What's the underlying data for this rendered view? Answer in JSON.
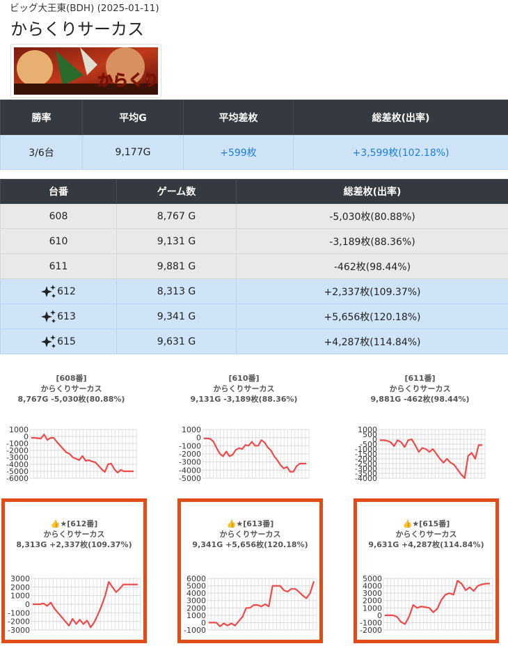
{
  "header": {
    "store_date": "ビッグ大王東(BDH) (2025-01-11)",
    "machine_title": "からくりサーカス",
    "banner_text": "からくりサーカス"
  },
  "summary": {
    "headers": [
      "勝率",
      "平均G",
      "平均差枚",
      "総差枚(出率)"
    ],
    "values": [
      "3/6台",
      "9,177G",
      "+599枚",
      "+3,599枚(102.18%)"
    ]
  },
  "units": {
    "headers": [
      "台番",
      "ゲーム数",
      "総差枚(出率)"
    ],
    "rows": [
      {
        "number": "608",
        "games": "8,767 G",
        "diff": "-5,030枚(80.88%)",
        "highlight": false
      },
      {
        "number": "610",
        "games": "9,131 G",
        "diff": "-3,189枚(88.36%)",
        "highlight": false
      },
      {
        "number": "611",
        "games": "9,881 G",
        "diff": "-462枚(98.44%)",
        "highlight": false
      },
      {
        "number": "612",
        "games": "8,313 G",
        "diff": "+2,337枚(109.37%)",
        "highlight": true
      },
      {
        "number": "613",
        "games": "9,341 G",
        "diff": "+5,656枚(120.18%)",
        "highlight": true
      },
      {
        "number": "615",
        "games": "9,631 G",
        "diff": "+4,287枚(114.84%)",
        "highlight": true
      }
    ]
  },
  "colors": {
    "line": "#f04848",
    "frame": "#e24a16",
    "header_bg": "#343a40",
    "highlight_bg": "#cfe4f7",
    "accent_text": "#1a7ee0"
  },
  "chart_data": [
    {
      "type": "line",
      "title": "[608番]",
      "subtitle": "からくりサーカス",
      "caption": "8,767G -5,030枚(80.88%)",
      "ylim": [
        -6000,
        1000
      ],
      "yticks": [
        1000,
        0,
        -1000,
        -2000,
        -3000,
        -4000,
        -5000,
        -6000
      ],
      "values": [
        -200,
        -200,
        -250,
        -300,
        300,
        -500,
        -200,
        -200,
        -800,
        -1300,
        -1800,
        -2300,
        -2500,
        -3000,
        -3200,
        -3400,
        -2800,
        -3500,
        -3400,
        -3600,
        -3700,
        -4200,
        -4700,
        -5100,
        -4000,
        -3900,
        -4700,
        -5200,
        -4800,
        -5000,
        -5000,
        -5000,
        -5000
      ]
    },
    {
      "type": "line",
      "title": "[610番]",
      "subtitle": "からくりサーカス",
      "caption": "9,131G -3,189枚(88.36%)",
      "ylim": [
        -5000,
        1000
      ],
      "yticks": [
        1000,
        0,
        -1000,
        -2000,
        -3000,
        -4000,
        -5000
      ],
      "values": [
        -100,
        -100,
        -150,
        -500,
        -1300,
        -2000,
        -2300,
        -1700,
        -2300,
        -2100,
        -1500,
        -1300,
        -1400,
        -900,
        -1000,
        -500,
        -1000,
        -1000,
        -300,
        -600,
        -1200,
        -1600,
        -2300,
        -2800,
        -3400,
        -3800,
        -3600,
        -4200,
        -4200,
        -3500,
        -3200,
        -3200,
        -3200
      ]
    },
    {
      "type": "line",
      "title": "[611番]",
      "subtitle": "からくりサーカス",
      "caption": "9,881G -462枚(98.44%)",
      "ylim": [
        -4000,
        1000
      ],
      "yticks": [
        1000,
        500,
        0,
        -500,
        -1000,
        -1500,
        -2000,
        -2500,
        -3000,
        -3500,
        -4000
      ],
      "values": [
        -100,
        -100,
        -150,
        -300,
        -700,
        -100,
        -300,
        -800,
        -100,
        0,
        -600,
        -1300,
        -900,
        -1000,
        -1300,
        -1000,
        -1500,
        -2000,
        -2400,
        -2000,
        -2400,
        -2600,
        -3100,
        -3600,
        -4000,
        -1700,
        -1400,
        -2000,
        -600,
        -600
      ]
    },
    {
      "type": "line",
      "title": "👍★[612番]",
      "subtitle": "からくりサーカス",
      "caption": "8,313G +2,337枚(109.37%)",
      "ylim": [
        -3000,
        3000
      ],
      "yticks": [
        3000,
        2000,
        1000,
        0,
        -1000,
        -2000,
        -3000
      ],
      "values": [
        0,
        0,
        0,
        100,
        -200,
        200,
        -500,
        -1000,
        -1500,
        -2000,
        -2500,
        -1700,
        -2300,
        -1800,
        -2300,
        -1900,
        -2700,
        -2100,
        -1200,
        -200,
        1000,
        2600,
        2000,
        1400,
        1800,
        2300,
        2300,
        2300,
        2300,
        2300
      ]
    },
    {
      "type": "line",
      "title": "👍★[613番]",
      "subtitle": "からくりサーカス",
      "caption": "9,341G +5,656枚(120.18%)",
      "ylim": [
        -1000,
        6000
      ],
      "yticks": [
        6000,
        5000,
        4000,
        3000,
        2000,
        1000,
        0,
        -1000
      ],
      "values": [
        0,
        0,
        0,
        -500,
        -100,
        -400,
        -100,
        -400,
        200,
        800,
        2000,
        2000,
        2400,
        2400,
        2200,
        2500,
        2200,
        5000,
        5000,
        5000,
        4400,
        4200,
        4600,
        4600,
        4200,
        3700,
        3300,
        4000,
        5600
      ]
    },
    {
      "type": "line",
      "title": "👍★[615番]",
      "subtitle": "からくりサーカス",
      "caption": "9,631G +4,287枚(114.84%)",
      "ylim": [
        -2000,
        5000
      ],
      "yticks": [
        5000,
        4000,
        3000,
        2000,
        1000,
        0,
        -1000,
        -2000
      ],
      "values": [
        0,
        0,
        0,
        -200,
        -900,
        -1200,
        -200,
        1400,
        1000,
        1200,
        1100,
        1000,
        400,
        900,
        2100,
        2800,
        3000,
        2800,
        4700,
        4300,
        3400,
        3800,
        3300,
        4000,
        4200,
        4300,
        4300
      ]
    }
  ]
}
